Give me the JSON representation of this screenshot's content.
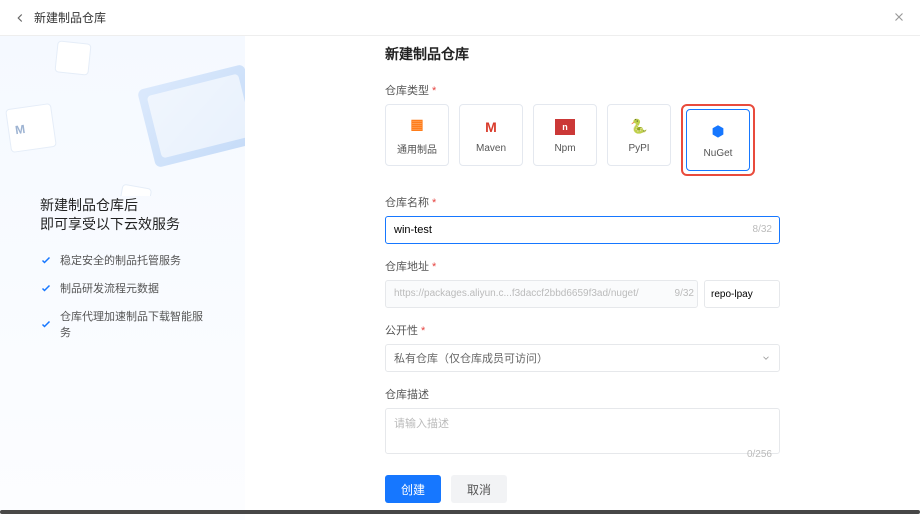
{
  "topbar": {
    "title": "新建制品仓库"
  },
  "sidebar": {
    "heading_l1": "新建制品仓库后",
    "heading_l2": "即可享受以下云效服务",
    "bullets": [
      "稳定安全的制品托管服务",
      "制品研发流程元数据",
      "仓库代理加速制品下载智能服务"
    ]
  },
  "form": {
    "title": "新建制品仓库",
    "type": {
      "label": "仓库类型",
      "options": [
        {
          "key": "generic",
          "name": "通用制品"
        },
        {
          "key": "maven",
          "name": "Maven"
        },
        {
          "key": "npm",
          "name": "Npm"
        },
        {
          "key": "pypi",
          "name": "PyPI"
        },
        {
          "key": "nuget",
          "name": "NuGet"
        }
      ],
      "selected": "nuget"
    },
    "name": {
      "label": "仓库名称",
      "value": "win-test",
      "counter": "8/32"
    },
    "addr": {
      "label": "仓库地址",
      "prefix": "https://packages.aliyun.c...f3daccf2bbd6659f3ad/nuget/",
      "slug": "repo-lpay",
      "counter": "9/32"
    },
    "visibility": {
      "label": "公开性",
      "value": "私有仓库（仅仓库成员可访问）"
    },
    "desc": {
      "label": "仓库描述",
      "placeholder": "请输入描述",
      "counter": "0/256"
    },
    "buttons": {
      "create": "创建",
      "cancel": "取消"
    }
  }
}
